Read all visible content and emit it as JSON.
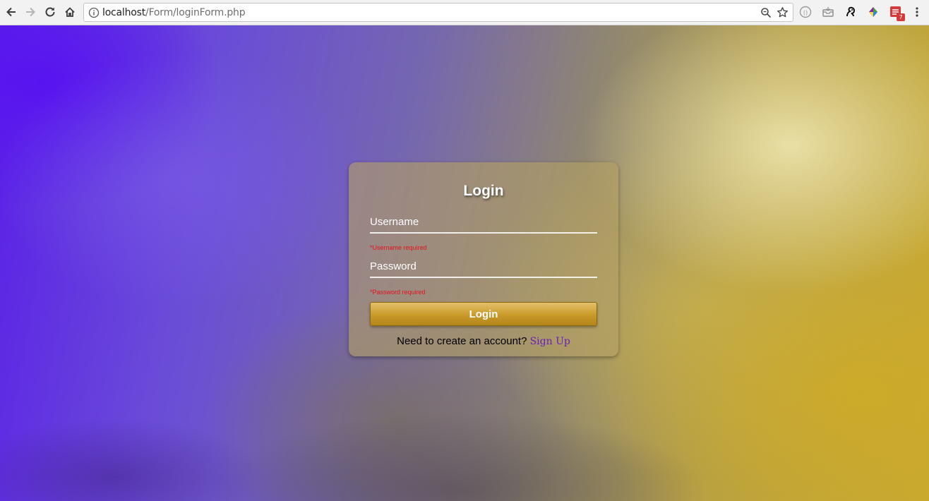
{
  "browser": {
    "url_host": "localhost",
    "url_path": "/Form/loginForm.php",
    "extension_badge": "7"
  },
  "icons": [
    "back-arrow-icon",
    "forward-arrow-icon",
    "reload-icon",
    "home-icon",
    "info-icon",
    "zoom-icon",
    "star-icon",
    "extension-icon"
  ],
  "colors": {
    "error": "#e3131d",
    "link": "#6a1fb8",
    "button": "#c99a2a",
    "background_left": "#5a1ee8",
    "background_right": "#c7a932"
  },
  "login_card": {
    "title": "Login",
    "username_placeholder": "Username",
    "username_error": "*Username required",
    "password_placeholder": "Password",
    "password_error": "*Password required",
    "login_button": "Login",
    "signup_prompt": "Need to create an account?",
    "signup_link": "Sign Up"
  }
}
